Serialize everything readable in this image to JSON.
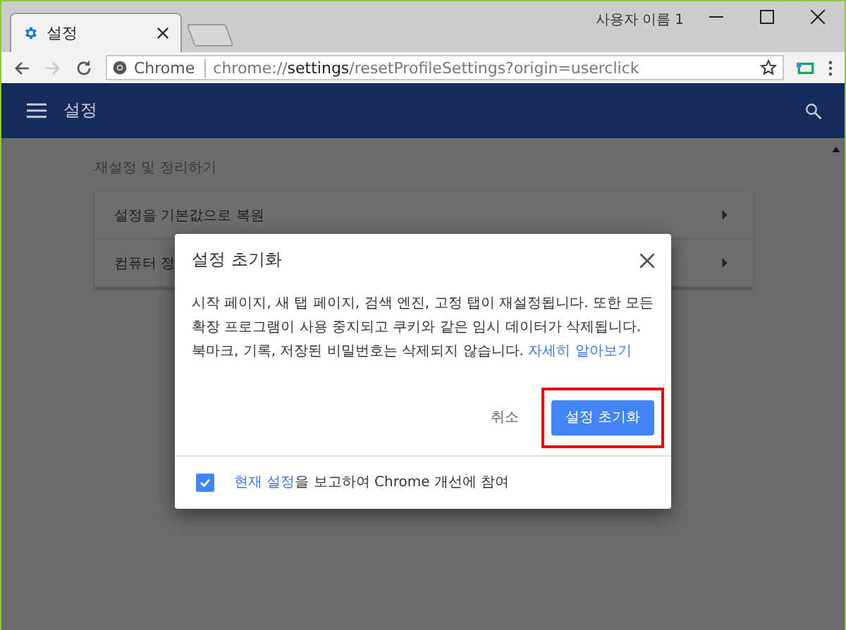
{
  "window": {
    "profile": "사용자 이름 1"
  },
  "tabs": [
    {
      "title": "설정",
      "selected": true
    }
  ],
  "toolbar": {
    "back_disabled": false,
    "forward_disabled": true,
    "origin": "Chrome",
    "url_prefix": "chrome://",
    "url_host": "settings",
    "url_rest": "/resetProfileSettings?origin=userclick"
  },
  "header": {
    "title": "설정"
  },
  "section": {
    "title": "재설정 및 정리하기",
    "rows": [
      {
        "label": "설정을 기본값으로 복원"
      },
      {
        "label": "컴퓨터 정"
      }
    ]
  },
  "dialog": {
    "title": "설정 초기화",
    "body": "시작 페이지, 새 탭 페이지, 검색 엔진, 고정 탭이 재설정됩니다. 또한 모든 확장 프로그램이 사용 중지되고 쿠키와 같은 임시 데이터가 삭제됩니다. 북마크, 기록, 저장된 비밀번호는 삭제되지 않습니다.",
    "link": "자세히 알아보기",
    "cancel": "취소",
    "confirm": "설정 초기화",
    "confirm_highlighted": true,
    "report_checked": true,
    "report_link": "현재 설정",
    "report_text": "을 보고하여 Chrome 개선에 참여"
  }
}
